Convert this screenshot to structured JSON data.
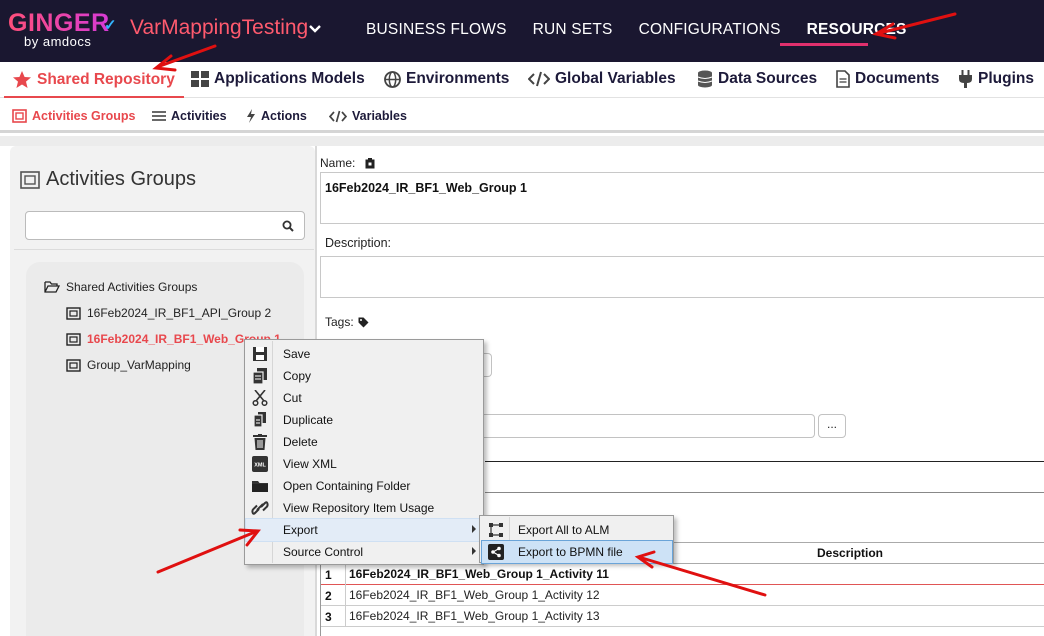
{
  "app": {
    "logo_text": "GINGER",
    "logo_sub": "by amdocs",
    "solution_name": "VarMappingTesting"
  },
  "top_nav": {
    "items": [
      "BUSINESS FLOWS",
      "RUN SETS",
      "CONFIGURATIONS",
      "RESOURCES"
    ],
    "active": "RESOURCES"
  },
  "resources_nav": {
    "shared_repository": "Shared Repository",
    "applications_models": "Applications Models",
    "environments": "Environments",
    "global_variables": "Global  Variables",
    "data_sources": "Data Sources",
    "documents": "Documents",
    "plugins": "Plugins"
  },
  "repo_nav": {
    "activities_groups": "Activities Groups",
    "activities": "Activities",
    "actions": "Actions",
    "variables": "Variables"
  },
  "left_panel": {
    "title": "Activities Groups",
    "search_value": "",
    "tree_root": "Shared Activities Groups",
    "tree_items": [
      "16Feb2024_IR_BF1_API_Group 2",
      "16Feb2024_IR_BF1_Web_Group 1",
      "Group_VarMapping"
    ],
    "selected_index": 1
  },
  "details": {
    "name_label": "Name:",
    "name_value": "16Feb2024_IR_BF1_Web_Group 1",
    "description_label": "Description:",
    "description_value": "",
    "tags_label": "Tags:",
    "browse_label": "...",
    "grid_header_description": "Description",
    "rows": [
      {
        "num": "1",
        "name": "16Feb2024_IR_BF1_Web_Group 1_Activity 11"
      },
      {
        "num": "2",
        "name": "16Feb2024_IR_BF1_Web_Group 1_Activity 12"
      },
      {
        "num": "3",
        "name": "16Feb2024_IR_BF1_Web_Group 1_Activity 13"
      }
    ]
  },
  "context_menu": {
    "items": [
      "Save",
      "Copy",
      "Cut",
      "Duplicate",
      "Delete",
      "View XML",
      "Open Containing Folder",
      "View Repository Item Usage",
      "Export",
      "Source Control"
    ],
    "xml_badge": "XML",
    "hovered": "Export"
  },
  "export_submenu": {
    "items": [
      "Export All to ALM",
      "Export to BPMN file"
    ],
    "hovered": "Export to BPMN file"
  },
  "colors": {
    "top_bar": "#1a1730",
    "accent_red": "#e8484d",
    "solution_name": "#ff5a6e",
    "underline": "#e0306d",
    "annotation_arrow": "#e01010"
  }
}
